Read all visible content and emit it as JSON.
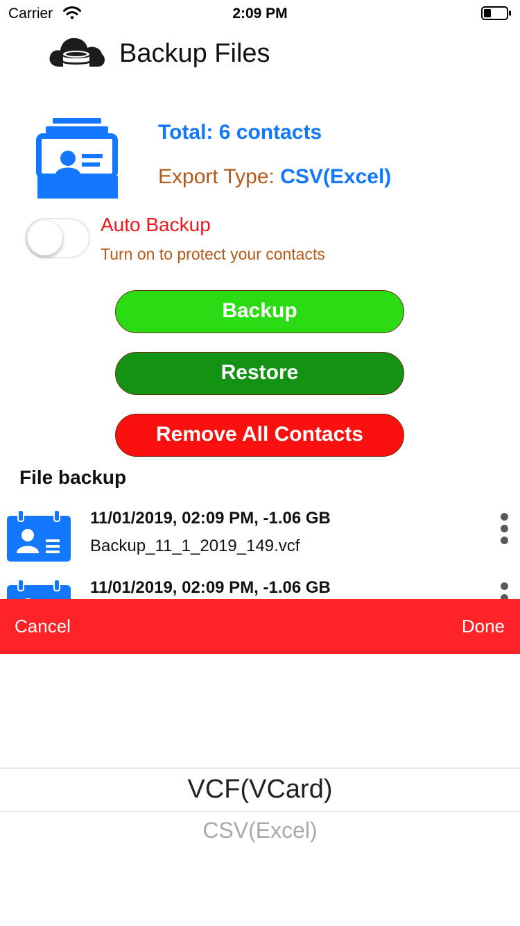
{
  "status_bar": {
    "carrier": "Carrier",
    "time": "2:09 PM"
  },
  "header": {
    "title": "Backup Files",
    "logo_icon": "cloud-database-icon"
  },
  "summary": {
    "total_text": "Total: 6 contacts",
    "export_label": "Export Type: ",
    "export_value": "CSV(Excel)"
  },
  "auto_backup": {
    "title": "Auto Backup",
    "subtitle": "Turn on to protect your contacts",
    "enabled": false
  },
  "buttons": {
    "backup": "Backup",
    "restore": "Restore",
    "remove_all": "Remove All Contacts"
  },
  "file_backup": {
    "section_title": "File backup",
    "items": [
      {
        "meta": "11/01/2019, 02:09 PM, -1.06 GB",
        "name": "Backup_11_1_2019_149.vcf"
      },
      {
        "meta": "11/01/2019, 02:09 PM, -1.06 GB",
        "name": ""
      }
    ]
  },
  "picker": {
    "cancel": "Cancel",
    "done": "Done",
    "options": [
      "VCF(VCard)",
      "CSV(Excel)"
    ],
    "selected": "VCF(VCard)"
  },
  "colors": {
    "blue_accent": "#1478ff",
    "brown_text": "#b25a1a",
    "red_text": "#f0161e",
    "backup_green": "#2bdb14",
    "restore_green": "#139213",
    "remove_red": "#fb1010",
    "toolbar_red": "#fd2329"
  }
}
